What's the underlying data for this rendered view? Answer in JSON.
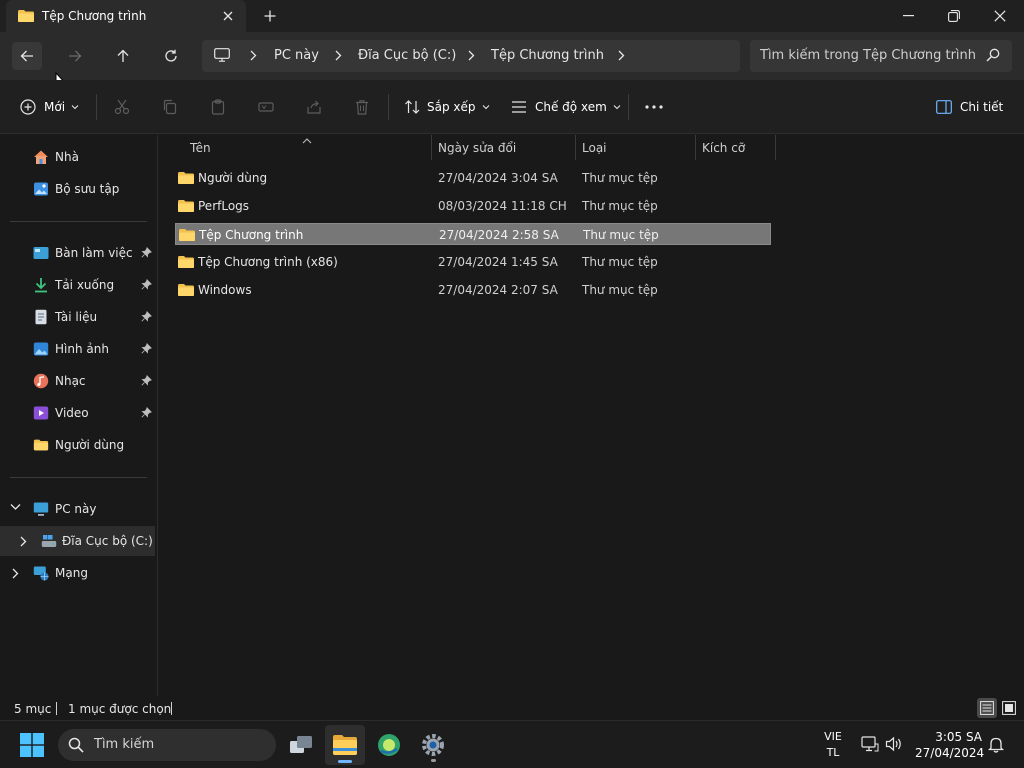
{
  "window": {
    "tab_title": "Tệp Chương trình",
    "new_tab_label": "+"
  },
  "nav": {
    "breadcrumb": [
      "PC này",
      "Đĩa Cục bộ (C:)",
      "Tệp Chương trình"
    ],
    "search_placeholder": "Tìm kiếm trong Tệp Chương trình"
  },
  "toolbar": {
    "new_label": "Mới",
    "sort_label": "Sắp xếp",
    "view_label": "Chế độ xem",
    "details_label": "Chi tiết"
  },
  "sidebar": {
    "top": [
      {
        "label": "Nhà",
        "icon": "home-icon"
      },
      {
        "label": "Bộ sưu tập",
        "icon": "gallery-icon"
      }
    ],
    "pinned": [
      {
        "label": "Bàn làm việc",
        "icon": "desktop-icon"
      },
      {
        "label": "Tải xuống",
        "icon": "download-icon"
      },
      {
        "label": "Tài liệu",
        "icon": "document-icon"
      },
      {
        "label": "Hình ảnh",
        "icon": "pictures-icon"
      },
      {
        "label": "Nhạc",
        "icon": "music-icon"
      },
      {
        "label": "Video",
        "icon": "video-icon"
      },
      {
        "label": "Người dùng",
        "icon": "folder-icon"
      }
    ],
    "tree": [
      {
        "label": "PC này",
        "icon": "pc-icon"
      },
      {
        "label": "Đĩa Cục bộ (C:)",
        "icon": "drive-icon"
      },
      {
        "label": "Mạng",
        "icon": "network-icon"
      }
    ]
  },
  "table": {
    "columns": [
      "Tên",
      "Ngày sửa đổi",
      "Loại",
      "Kích cỡ"
    ],
    "rows": [
      {
        "name": "Người dùng",
        "date": "27/04/2024 3:04 SA",
        "type": "Thư mục tệp"
      },
      {
        "name": "PerfLogs",
        "date": "08/03/2024 11:18 CH",
        "type": "Thư mục tệp"
      },
      {
        "name": "Tệp Chương trình",
        "date": "27/04/2024 2:58 SA",
        "type": "Thư mục tệp"
      },
      {
        "name": "Tệp Chương trình (x86)",
        "date": "27/04/2024 1:45 SA",
        "type": "Thư mục tệp"
      },
      {
        "name": "Windows",
        "date": "27/04/2024 2:07 SA",
        "type": "Thư mục tệp"
      }
    ]
  },
  "status": {
    "item_count": "5 mục",
    "selected": "1 mục được chọn"
  },
  "taskbar": {
    "search_placeholder": "Tìm kiếm",
    "lang_top": "VIE",
    "lang_bottom": "TL",
    "time": "3:05 SA",
    "date": "27/04/2024"
  },
  "colors": {
    "accent": "#6fb6ff",
    "folder": "#f2c14e",
    "selected_row": "#777777"
  }
}
